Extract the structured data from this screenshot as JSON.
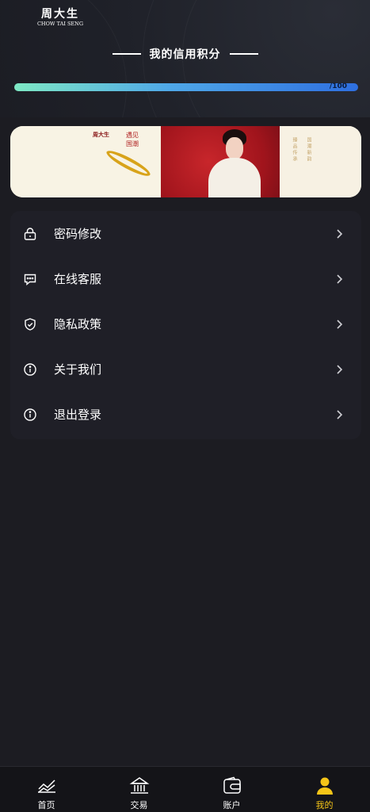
{
  "header": {
    "brand_cn": "周大生",
    "brand_en": "CHOW TAI SENG",
    "credit_title": "我的信用积分",
    "progress": {
      "percent": 100,
      "label": "/100"
    }
  },
  "banner": {
    "mini_logo": "周大生",
    "tagline": "遇见国潮",
    "side_text_1": "臻品传承",
    "side_text_2": "国潮新韵"
  },
  "menu": {
    "items": [
      {
        "label": "密码修改",
        "icon": "lock-icon"
      },
      {
        "label": "在线客服",
        "icon": "chat-icon"
      },
      {
        "label": "隐私政策",
        "icon": "shield-icon"
      },
      {
        "label": "关于我们",
        "icon": "info-icon"
      },
      {
        "label": "退出登录",
        "icon": "info-icon"
      }
    ]
  },
  "tabbar": {
    "tabs": [
      {
        "label": "首页",
        "icon": "chart-line-icon",
        "active": false
      },
      {
        "label": "交易",
        "icon": "bank-icon",
        "active": false
      },
      {
        "label": "账户",
        "icon": "wallet-icon",
        "active": false
      },
      {
        "label": "我的",
        "icon": "user-icon",
        "active": true
      }
    ]
  },
  "colors": {
    "background": "#1c1c22",
    "card": "#1f1f27",
    "accent": "#f5c518",
    "progress_start": "#7ee8c4",
    "progress_end": "#2e6fe0"
  }
}
